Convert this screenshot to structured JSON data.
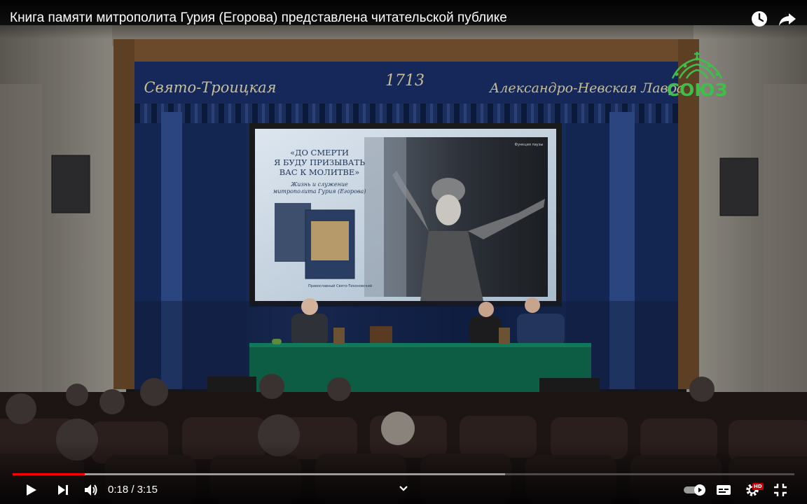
{
  "video": {
    "title": "Книга памяти митрополита Гурия (Егорова) представлена читательской публике"
  },
  "scene": {
    "arch_left": "Свято-Троицкая",
    "arch_center": "1713",
    "arch_right": "Александро-Невская Лавра",
    "slide_title": "«ДО СМЕРТИ\nЯ БУДУ ПРИЗЫВАТЬ\nВАС К МОЛИТВЕ»",
    "slide_line1": "«ДО СМЕРТИ",
    "slide_line2": "Я БУДУ ПРИЗЫВАТЬ",
    "slide_line3": "ВАС К МОЛИТВЕ»",
    "slide_subtitle_1": "Жизнь и служение",
    "slide_subtitle_2": "митрополита Гурия (Егорова)",
    "slide_corner": "Функция паузы",
    "slide_publisher": "Православный Свято-Тихоновский"
  },
  "channel_logo": {
    "text": "СОЮЗ",
    "color": "#3fbf4a"
  },
  "controls": {
    "current_time": "0:18",
    "separator": " / ",
    "duration": "3:15",
    "progress_fraction": 0.092,
    "buffered_fraction": 0.63,
    "hd_badge": "HD",
    "icons": [
      "play-icon",
      "next-icon",
      "volume-icon",
      "chevron-down-icon",
      "autoplay-toggle-icon",
      "subtitles-icon",
      "settings-icon",
      "exit-fullscreen-icon",
      "watch-later-icon",
      "share-icon"
    ],
    "accent_color": "#ff0000"
  }
}
